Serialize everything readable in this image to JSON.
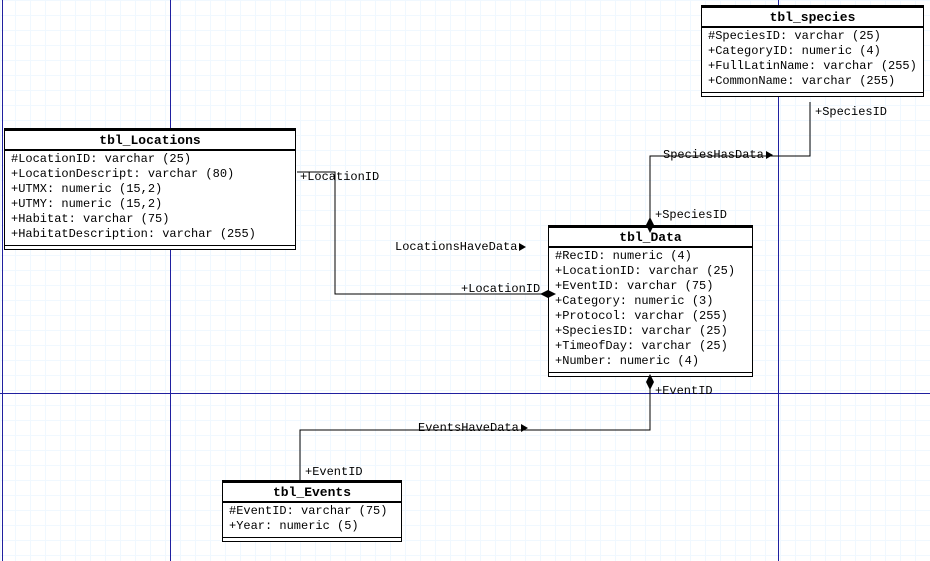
{
  "entities": {
    "locations": {
      "title": "tbl_Locations",
      "attrs": [
        "#LocationID: varchar (25)",
        "+LocationDescript: varchar (80)",
        "+UTMX: numeric (15,2)",
        "+UTMY: numeric (15,2)",
        "+Habitat: varchar (75)",
        "+HabitatDescription: varchar (255)"
      ]
    },
    "species": {
      "title": "tbl_species",
      "attrs": [
        "#SpeciesID: varchar (25)",
        "+CategoryID: numeric (4)",
        "+FullLatinName: varchar (255)",
        "+CommonName: varchar (255)"
      ]
    },
    "data": {
      "title": "tbl_Data",
      "attrs": [
        "#RecID: numeric (4)",
        "+LocationID: varchar (25)",
        "+EventID: varchar (75)",
        "+Category: numeric (3)",
        "+Protocol: varchar (255)",
        "+SpeciesID: varchar (25)",
        "+TimeofDay: varchar (25)",
        "+Number: numeric (4)"
      ]
    },
    "events": {
      "title": "tbl_Events",
      "attrs": [
        "#EventID: varchar (75)",
        "+Year: numeric (5)"
      ]
    }
  },
  "relationships": {
    "locations_data": {
      "name": "LocationsHaveData",
      "role_parent": "+LocationID",
      "role_child": "+LocationID"
    },
    "species_data": {
      "name": "SpeciesHasData",
      "role_parent": "+SpeciesID",
      "role_child": "+SpeciesID"
    },
    "events_data": {
      "name": "EventsHaveData",
      "role_parent": "+EventID",
      "role_child": "+EventID"
    }
  }
}
